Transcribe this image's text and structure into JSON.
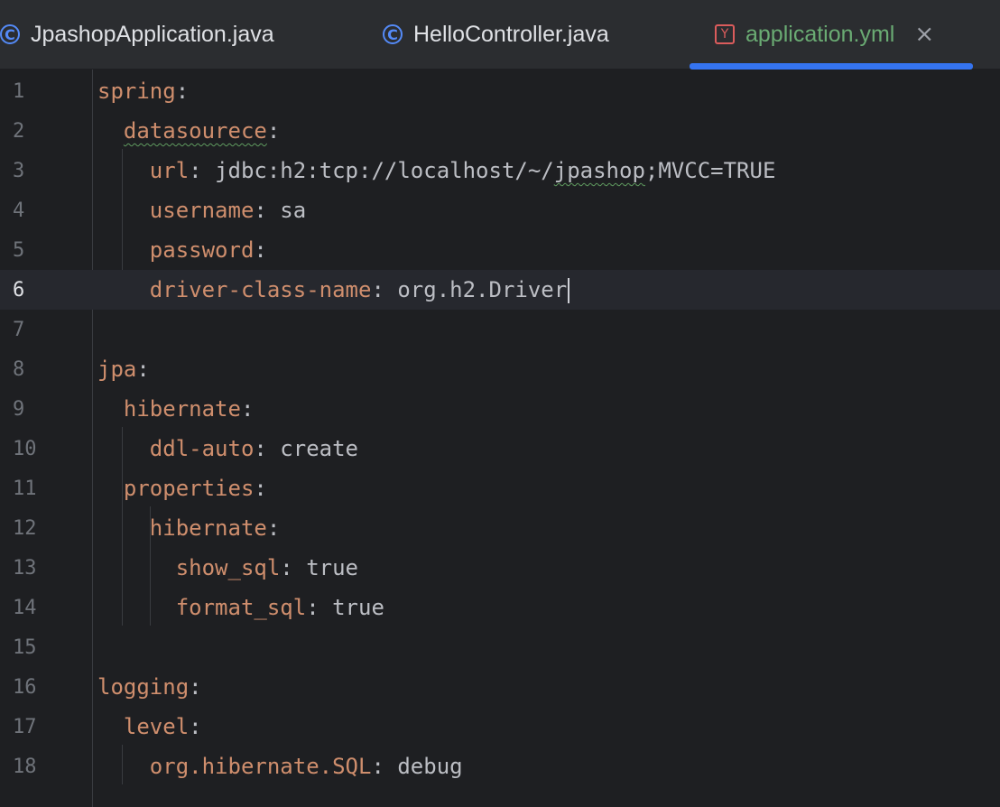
{
  "tabs": [
    {
      "label": "JpashopApplication.java",
      "icon": "class-icon",
      "icon_glyph": "C",
      "active": false
    },
    {
      "label": "HelloController.java",
      "icon": "class-icon",
      "icon_glyph": "C",
      "active": false
    },
    {
      "label": "application.yml",
      "icon": "yaml-icon",
      "icon_glyph": "Y",
      "active": true,
      "close_glyph": "×"
    }
  ],
  "editor": {
    "current_line": 6,
    "line_numbers": [
      "1",
      "2",
      "3",
      "4",
      "5",
      "6",
      "7",
      "8",
      "9",
      "10",
      "11",
      "12",
      "13",
      "14",
      "15",
      "16",
      "17",
      "18"
    ],
    "lines": [
      {
        "indent": "",
        "key": "spring",
        "sep": ":",
        "value": ""
      },
      {
        "indent": "  ",
        "key": "datasourece",
        "sep": ":",
        "value": ""
      },
      {
        "indent": "    ",
        "key": "url",
        "sep": ": ",
        "value_a": "jdbc:h2:tcp://localhost/~/",
        "value_b": "jpashop",
        "value_c": ";MVCC=TRUE"
      },
      {
        "indent": "    ",
        "key": "username",
        "sep": ": ",
        "value": "sa"
      },
      {
        "indent": "    ",
        "key": "password",
        "sep": ":",
        "value": ""
      },
      {
        "indent": "    ",
        "key": "driver-class-name",
        "sep": ": ",
        "value": "org.h2.Driver"
      },
      {
        "indent": "",
        "key": "",
        "sep": "",
        "value": ""
      },
      {
        "indent": "",
        "key": "jpa",
        "sep": ":",
        "value": ""
      },
      {
        "indent": "  ",
        "key": "hibernate",
        "sep": ":",
        "value": ""
      },
      {
        "indent": "    ",
        "key": "ddl-auto",
        "sep": ": ",
        "value": "create"
      },
      {
        "indent": "  ",
        "key": "properties",
        "sep": ":",
        "value": ""
      },
      {
        "indent": "    ",
        "key": "hibernate",
        "sep": ":",
        "value": ""
      },
      {
        "indent": "      ",
        "key": "show_sql",
        "sep": ": ",
        "value": "true"
      },
      {
        "indent": "      ",
        "key": "format_sql",
        "sep": ": ",
        "value": "true"
      },
      {
        "indent": "",
        "key": "",
        "sep": "",
        "value": ""
      },
      {
        "indent": "",
        "key": "logging",
        "sep": ":",
        "value": ""
      },
      {
        "indent": "  ",
        "key": "level",
        "sep": ":",
        "value": ""
      },
      {
        "indent": "    ",
        "key": "org.hibernate.SQL",
        "sep": ": ",
        "value": "debug"
      }
    ]
  },
  "colors": {
    "key": "#cf8e6d",
    "text": "#bcbec4",
    "active_tab_label": "#6aab73",
    "tab_underline": "#3574f0",
    "background": "#1e1f22"
  }
}
